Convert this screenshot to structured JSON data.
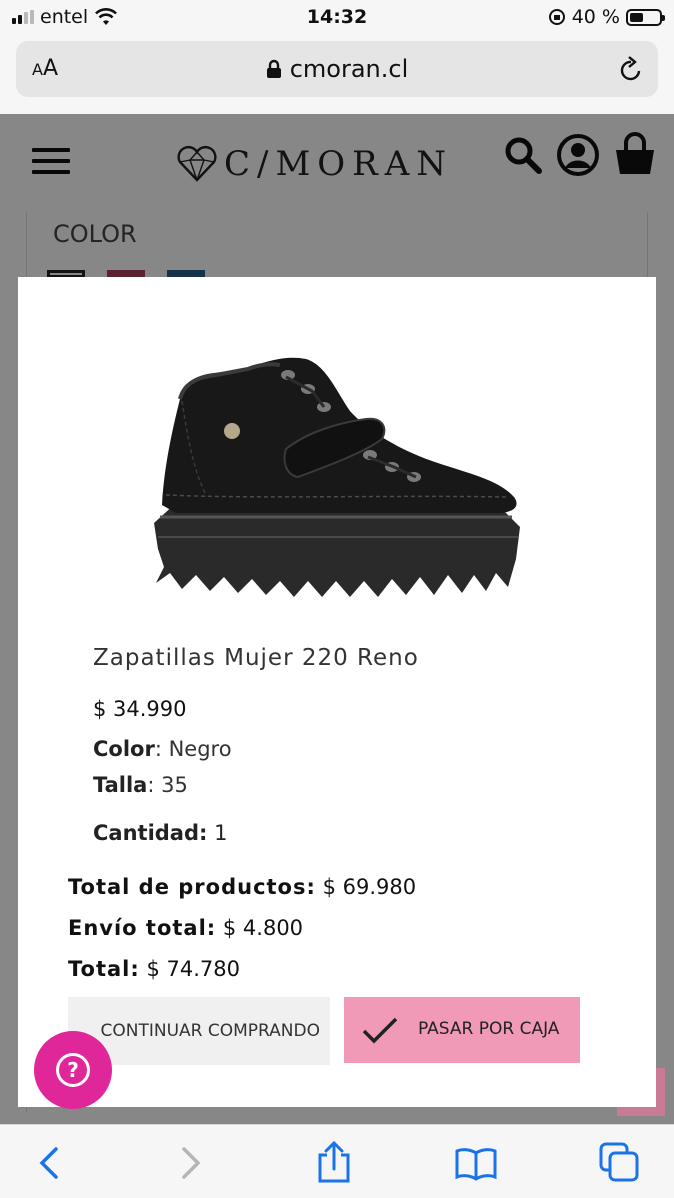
{
  "status_bar": {
    "carrier": "entel",
    "time": "14:32",
    "battery": "40 %"
  },
  "browser": {
    "text_size_label_small": "A",
    "text_size_label_large": "A",
    "url": "cmoran.cl"
  },
  "site_header": {
    "logo_text": "C/MORAN",
    "icons": [
      "menu-icon",
      "search-icon",
      "account-icon",
      "cart-icon"
    ]
  },
  "page": {
    "color_label": "COLOR",
    "swatch_colors": [
      "#222222",
      "#b0405a",
      "#2b5f8a"
    ]
  },
  "modal": {
    "product_name": "Zapatillas Mujer 220 Reno",
    "price": "$ 34.990",
    "color_label": "Color",
    "color_value": "Negro",
    "size_label": "Talla",
    "size_value": "35",
    "quantity_label": "Cantidad:",
    "quantity_value": "1",
    "subtotal_label": "Total de productos:",
    "subtotal_value": "$ 69.980",
    "shipping_label": "Envío total:",
    "shipping_value": "$ 4.800",
    "total_label": "Total:",
    "total_value": "$ 74.780",
    "continue_button": "CONTINUAR COMPRANDO",
    "checkout_button": "PASAR POR CAJA"
  },
  "help_button": {
    "glyph": "?"
  },
  "colors": {
    "accent_pink": "#f09ab8",
    "fab_magenta": "#e0279a"
  }
}
